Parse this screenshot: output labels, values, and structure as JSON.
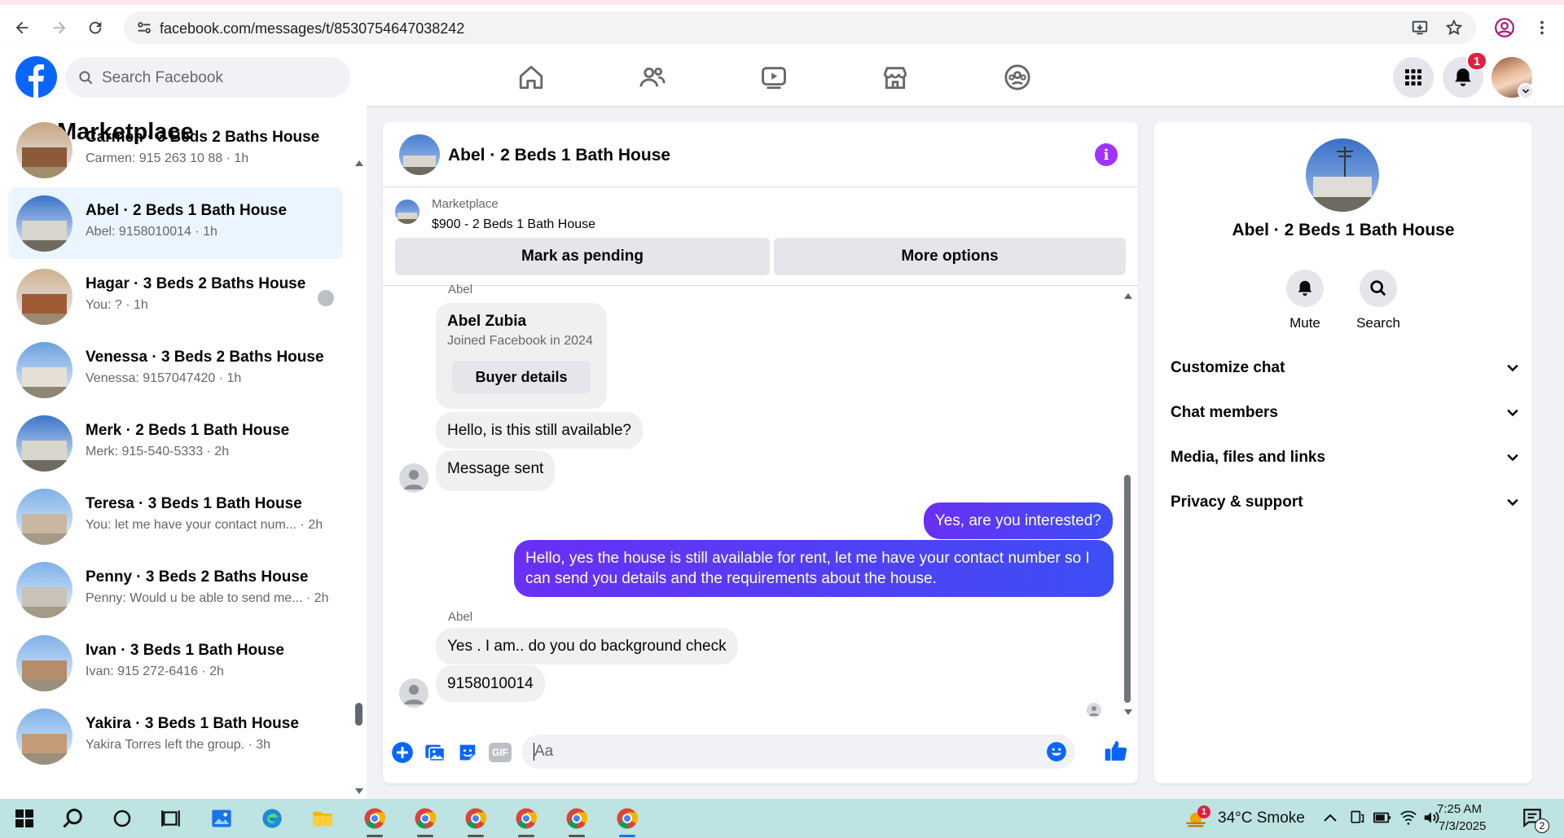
{
  "browser": {
    "url": "facebook.com/messages/t/8530754647038242"
  },
  "fb": {
    "search_placeholder": "Search Facebook",
    "notification_count": "1"
  },
  "left": {
    "title": "Marketplace",
    "conversations": [
      {
        "title": "Carmen · 3 Beds 2 Baths House",
        "sub": "Carmen: 915 263 10 88 · 1h",
        "active": false
      },
      {
        "title": "Abel · 2 Beds 1 Bath House",
        "sub": "Abel: 9158010014 · 1h",
        "active": true
      },
      {
        "title": "Hagar · 3 Beds 2 Baths House",
        "sub": "You: ? · 1h",
        "active": false
      },
      {
        "title": "Venessa · 3 Beds 2 Baths House",
        "sub": "Venessa: 9157047420 · 1h",
        "active": false
      },
      {
        "title": "Merk · 2 Beds 1 Bath House",
        "sub": "Merk: 915-540-5333 · 2h",
        "active": false
      },
      {
        "title": "Teresa · 3 Beds 1 Bath House",
        "sub": "You: let me have your contact num...  · 2h",
        "active": false
      },
      {
        "title": "Penny · 3 Beds 2 Baths House",
        "sub": "Penny: Would u be able to send me... · 2h",
        "active": false
      },
      {
        "title": "Ivan · 3 Beds 1 Bath House",
        "sub": "Ivan: 915 272-6416 · 2h",
        "active": false
      },
      {
        "title": "Yakira · 3 Beds 1 Bath House",
        "sub": "Yakira Torres left the group. · 3h",
        "active": false
      }
    ]
  },
  "chat": {
    "title": "Abel · 2 Beds 1 Bath House",
    "marketplace_label": "Marketplace",
    "listing": "$900 - 2 Beds 1 Bath House",
    "mark_pending": "Mark as pending",
    "more_options": "More options",
    "sender_top": "Abel",
    "card_name": "Abel Zubia",
    "card_joined": "Joined Facebook in 2024",
    "card_button": "Buyer details",
    "msg1": "Hello, is this still available?",
    "msg2": "Message sent",
    "me1": "Yes, are you interested?",
    "me2": "Hello, yes the house is still available for rent, let me have your contact number so I can send you details and the requirements about the house.",
    "sender_bottom": "Abel",
    "msg3": "Yes . I am.. do you do background check",
    "msg4": "9158010014",
    "composer_placeholder": "Aa",
    "gif_label": "GIF"
  },
  "right": {
    "title": "Abel · 2 Beds 1 Bath House",
    "mute": "Mute",
    "search": "Search",
    "sections": [
      "Customize chat",
      "Chat members",
      "Media, files and links",
      "Privacy & support"
    ]
  },
  "taskbar": {
    "weather": "34°C  Smoke",
    "time": "7:25 AM",
    "date": "7/3/2025",
    "notif_count": "2",
    "weather_badge": "1"
  },
  "colors": {
    "fb_blue": "#0866ff",
    "my_bubble": "#5b3df5",
    "active_conv": "#ebf5ff",
    "info_purple": "#a033ff"
  }
}
